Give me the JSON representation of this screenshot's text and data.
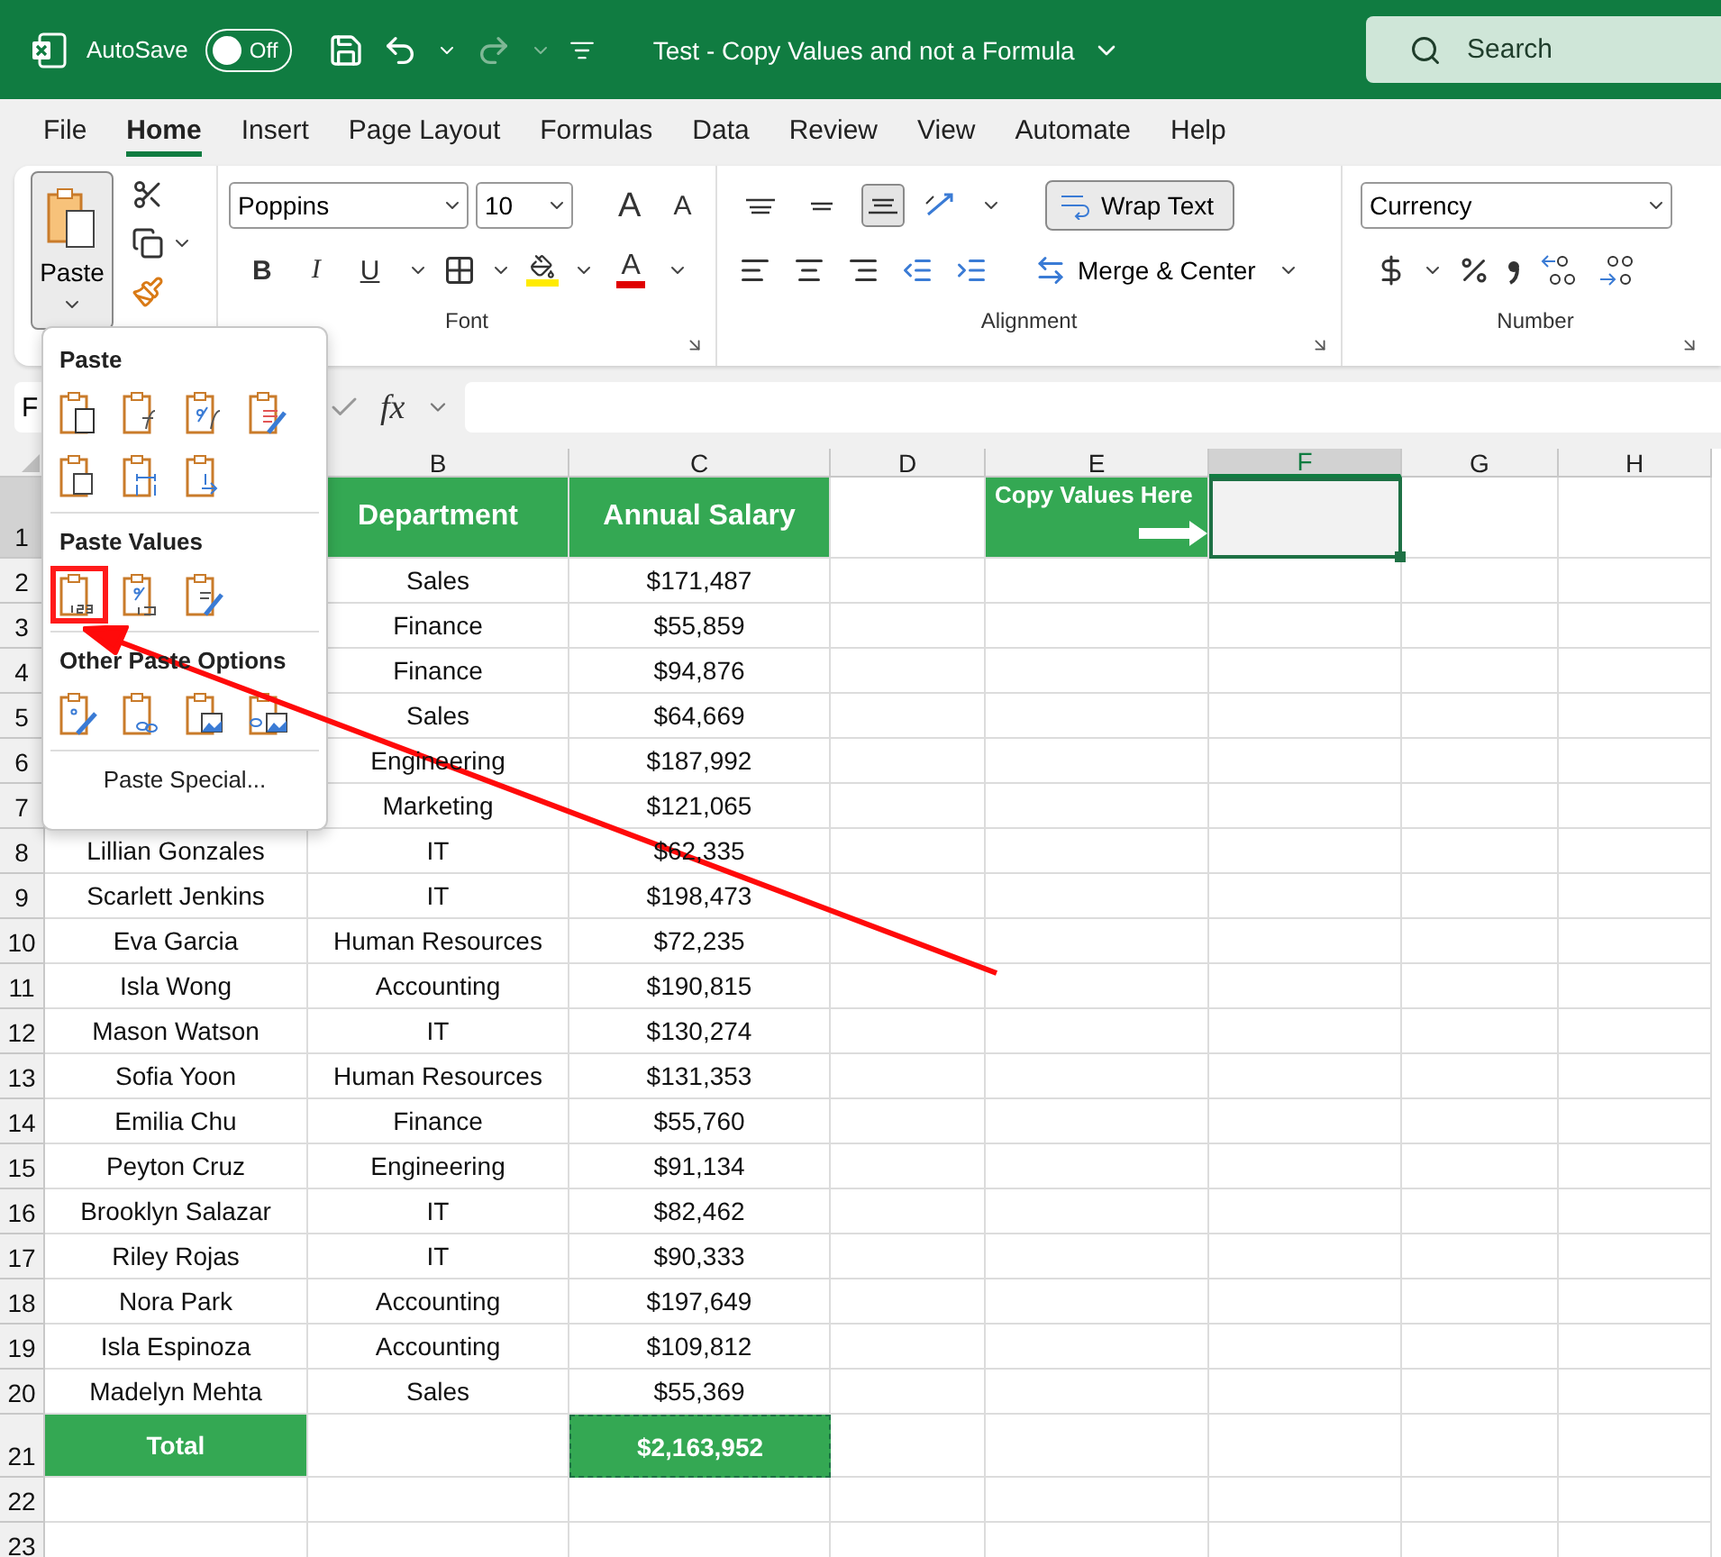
{
  "title_bar": {
    "autosave_label": "AutoSave",
    "autosave_on": false,
    "toggle_text": "Off",
    "document_title": "Test - Copy Values and not a Formula",
    "search_placeholder": "Search"
  },
  "menu_tabs": [
    {
      "label": "File",
      "selected": false
    },
    {
      "label": "Home",
      "selected": true
    },
    {
      "label": "Insert",
      "selected": false
    },
    {
      "label": "Page Layout",
      "selected": false
    },
    {
      "label": "Formulas",
      "selected": false
    },
    {
      "label": "Data",
      "selected": false
    },
    {
      "label": "Review",
      "selected": false
    },
    {
      "label": "View",
      "selected": false
    },
    {
      "label": "Automate",
      "selected": false
    },
    {
      "label": "Help",
      "selected": false
    }
  ],
  "ribbon": {
    "clipboard": {
      "paste_label": "Paste"
    },
    "font": {
      "font_name": "Poppins",
      "font_size": "10",
      "grow": "A",
      "shrink": "A",
      "bold": "B",
      "italic": "I",
      "underline": "U",
      "font_color": "A",
      "group_label": "Font"
    },
    "alignment": {
      "vertical": [
        {
          "kind": "top",
          "selected": false
        },
        {
          "kind": "middle",
          "selected": false
        },
        {
          "kind": "bottom",
          "selected": true
        }
      ],
      "wrap_text": {
        "label": "Wrap Text",
        "selected": true
      },
      "merge_label": "Merge & Center",
      "group_label": "Alignment"
    },
    "number": {
      "format": "Currency",
      "group_label": "Number"
    }
  },
  "formula_bar": {
    "name_box": "F",
    "fx": "fx"
  },
  "columns": [
    {
      "label": "B",
      "selected": false
    },
    {
      "label": "C",
      "selected": false
    },
    {
      "label": "D",
      "selected": false
    },
    {
      "label": "E",
      "selected": false
    },
    {
      "label": "F",
      "selected": true
    },
    {
      "label": "G",
      "selected": false
    },
    {
      "label": "H",
      "selected": false
    }
  ],
  "header_row": {
    "number": "1",
    "selected": true,
    "department": "Department",
    "salary": "Annual Salary",
    "note": "Copy Values Here"
  },
  "rows": [
    {
      "number": "2",
      "department": "Sales",
      "salary": "$171,487"
    },
    {
      "number": "3",
      "department": "Finance",
      "salary": "$55,859"
    },
    {
      "number": "4",
      "department": "Finance",
      "salary": "$94,876"
    },
    {
      "number": "5",
      "department": "Sales",
      "salary": "$64,669"
    },
    {
      "number": "6",
      "department": "Engineering",
      "salary": "$187,992"
    },
    {
      "number": "7",
      "department": "Marketing",
      "salary": "$121,065"
    },
    {
      "number": "8",
      "name": "Lillian Gonzales",
      "department": "IT",
      "salary": "$62,335"
    },
    {
      "number": "9",
      "name": "Scarlett Jenkins",
      "department": "IT",
      "salary": "$198,473"
    },
    {
      "number": "10",
      "name": "Eva Garcia",
      "department": "Human Resources",
      "salary": "$72,235"
    },
    {
      "number": "11",
      "name": "Isla Wong",
      "department": "Accounting",
      "salary": "$190,815"
    },
    {
      "number": "12",
      "name": "Mason Watson",
      "department": "IT",
      "salary": "$130,274"
    },
    {
      "number": "13",
      "name": "Sofia Yoon",
      "department": "Human Resources",
      "salary": "$131,353"
    },
    {
      "number": "14",
      "name": "Emilia Chu",
      "department": "Finance",
      "salary": "$55,760"
    },
    {
      "number": "15",
      "name": "Peyton Cruz",
      "department": "Engineering",
      "salary": "$91,134"
    },
    {
      "number": "16",
      "name": "Brooklyn Salazar",
      "department": "IT",
      "salary": "$82,462"
    },
    {
      "number": "17",
      "name": "Riley Rojas",
      "department": "IT",
      "salary": "$90,333"
    },
    {
      "number": "18",
      "name": "Nora Park",
      "department": "Accounting",
      "salary": "$197,649"
    },
    {
      "number": "19",
      "name": "Isla Espinoza",
      "department": "Accounting",
      "salary": "$109,812"
    },
    {
      "number": "20",
      "name": "Madelyn Mehta",
      "department": "Sales",
      "salary": "$55,369"
    }
  ],
  "total_row": {
    "number": "21",
    "label": "Total",
    "salary": "$2,163,952"
  },
  "empty_rows": [
    "22",
    "23"
  ],
  "paste_menu": {
    "sections": [
      {
        "title": "Paste",
        "items": [
          {
            "kind": "paste",
            "highlighted": false
          },
          {
            "kind": "formulas",
            "highlighted": false
          },
          {
            "kind": "formulas-number",
            "highlighted": false
          },
          {
            "kind": "keep-source",
            "highlighted": false
          },
          {
            "kind": "no-borders",
            "highlighted": false
          },
          {
            "kind": "column-widths",
            "highlighted": false
          },
          {
            "kind": "transpose",
            "highlighted": false
          }
        ]
      },
      {
        "title": "Paste Values",
        "items": [
          {
            "kind": "values",
            "highlighted": true
          },
          {
            "kind": "values-number",
            "highlighted": false
          },
          {
            "kind": "values-source",
            "highlighted": false
          }
        ]
      },
      {
        "title": "Other Paste Options",
        "items": [
          {
            "kind": "formatting",
            "highlighted": false
          },
          {
            "kind": "link",
            "highlighted": false
          },
          {
            "kind": "picture",
            "highlighted": false
          },
          {
            "kind": "linked-picture",
            "highlighted": false
          }
        ]
      }
    ],
    "footer": "Paste Special..."
  }
}
